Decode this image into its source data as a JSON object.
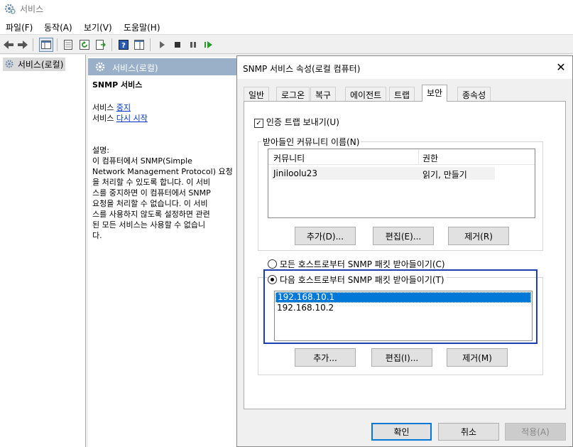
{
  "window": {
    "title": "서비스"
  },
  "menu": [
    "파일(F)",
    "동작(A)",
    "보기(V)",
    "도움말(H)"
  ],
  "tree": {
    "root": "서비스(로컬)"
  },
  "pane": {
    "header": "서비스(로컬)",
    "service_name": "SNMP 서비스",
    "stop_prefix": "서비스 ",
    "stop_link": "중지",
    "restart_prefix": "서비스 ",
    "restart_link": "다시 시작",
    "desc_label": "설명:",
    "desc_lines": [
      "이 컴퓨터에서 SNMP(Simple",
      "Network Management Protocol) 요청",
      "을 처리할 수 있도록 합니다. 이 서비",
      "스를 중지하면 이 컴퓨터에서 SNMP",
      "요청을 처리할 수 없습니다. 이 서비",
      "스를 사용하지 않도록 설정하면 관련",
      "된 모든 서비스는 사용할 수 없습니",
      "다."
    ]
  },
  "dialog": {
    "title": "SNMP 서비스 속성(로컬 컴퓨터)",
    "tabs": [
      "일반",
      "로그온",
      "복구",
      "에이전트",
      "트랩",
      "보안",
      "종속성"
    ],
    "active_tab": "보안",
    "send_trap_label": "인증 트랩 보내기(U)",
    "community_group_label": "받아들인 커뮤니티 이름(N)",
    "community_columns": [
      "커뮤니티",
      "권한"
    ],
    "community_rows": [
      [
        "Jiniloolu23",
        "읽기, 만들기"
      ]
    ],
    "community_buttons": [
      "추가(D)...",
      "편집(E)...",
      "제거(R)"
    ],
    "radio_any_label": "모든 호스트로부터 SNMP 패킷 받아들이기(C)",
    "radio_these_label": "다음 호스트로부터 SNMP 패킷 받아들이기(T)",
    "hosts": [
      "192.168.10.1",
      "192.168.10.2"
    ],
    "host_buttons": [
      "추가...",
      "편집(I)...",
      "제거(M)"
    ],
    "ok": "확인",
    "cancel": "취소",
    "apply": "적용(A)"
  }
}
